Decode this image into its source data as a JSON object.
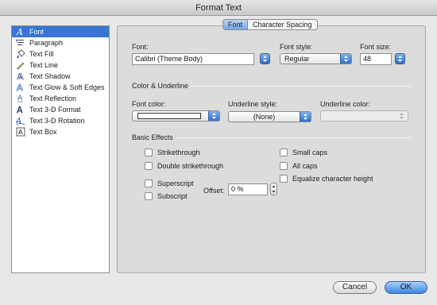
{
  "window": {
    "title": "Format Text"
  },
  "sidebar": {
    "items": [
      {
        "label": "Font",
        "icon": "font-a-icon",
        "selected": true
      },
      {
        "label": "Paragraph",
        "icon": "paragraph-icon"
      },
      {
        "label": "Text Fill",
        "icon": "paint-bucket-icon"
      },
      {
        "label": "Text Line",
        "icon": "pencil-icon"
      },
      {
        "label": "Text Shadow",
        "icon": "text-shadow-icon"
      },
      {
        "label": "Text Glow & Soft Edges",
        "icon": "text-glow-icon"
      },
      {
        "label": "Text Reflection",
        "icon": "text-reflection-icon"
      },
      {
        "label": "Text 3-D Format",
        "icon": "text-3d-format-icon"
      },
      {
        "label": "Text 3-D Rotation",
        "icon": "text-3d-rotation-icon"
      },
      {
        "label": "Text Box",
        "icon": "text-box-icon"
      }
    ]
  },
  "tabs": {
    "font": "Font",
    "spacing": "Character Spacing",
    "active": "Font"
  },
  "font": {
    "font_label": "Font:",
    "font_value": "Calibri (Theme Body)",
    "style_label": "Font style:",
    "style_value": "Regular",
    "size_label": "Font size:",
    "size_value": "48"
  },
  "color_section": {
    "title": "Color & Underline",
    "font_color_label": "Font color:",
    "font_color_value": "#ffffff",
    "underline_style_label": "Underline style:",
    "underline_style_value": "(None)",
    "underline_color_label": "Underline color:"
  },
  "effects": {
    "title": "Basic Effects",
    "strikethrough": "Strikethrough",
    "double_strikethrough": "Double strikethrough",
    "superscript": "Superscript",
    "subscript": "Subscript",
    "small_caps": "Small caps",
    "all_caps": "All caps",
    "equalize": "Equalize character height",
    "offset_label": "Offset:",
    "offset_value": "0 %"
  },
  "buttons": {
    "cancel": "Cancel",
    "ok": "OK"
  },
  "colors": {
    "accent": "#3875d7",
    "selection": "#3875d7"
  }
}
